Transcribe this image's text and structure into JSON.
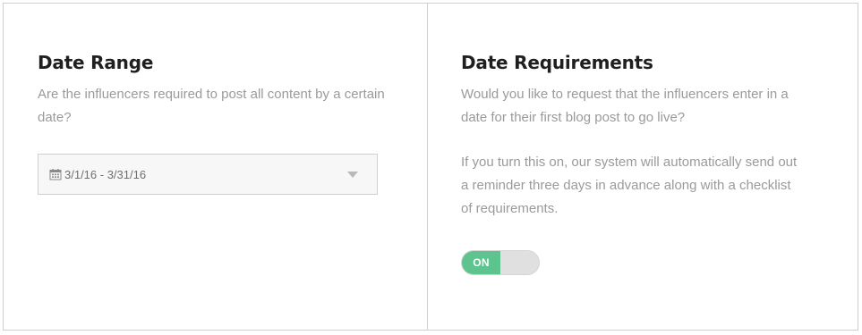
{
  "date_range": {
    "title": "Date Range",
    "description": "Are the influencers required to post all content by a certain date?",
    "select": {
      "icon": "calendar-icon",
      "value": "3/1/16 - 3/31/16"
    }
  },
  "date_requirements": {
    "title": "Date Requirements",
    "description": "Would you like to request that the influencers enter in a date for their first blog post to go live?",
    "note": "If you turn this on, our system will automatically send out a reminder three days in advance along with a checklist of requirements.",
    "toggle": {
      "label": "ON",
      "state": "on",
      "on_color": "#5ec48f"
    }
  }
}
